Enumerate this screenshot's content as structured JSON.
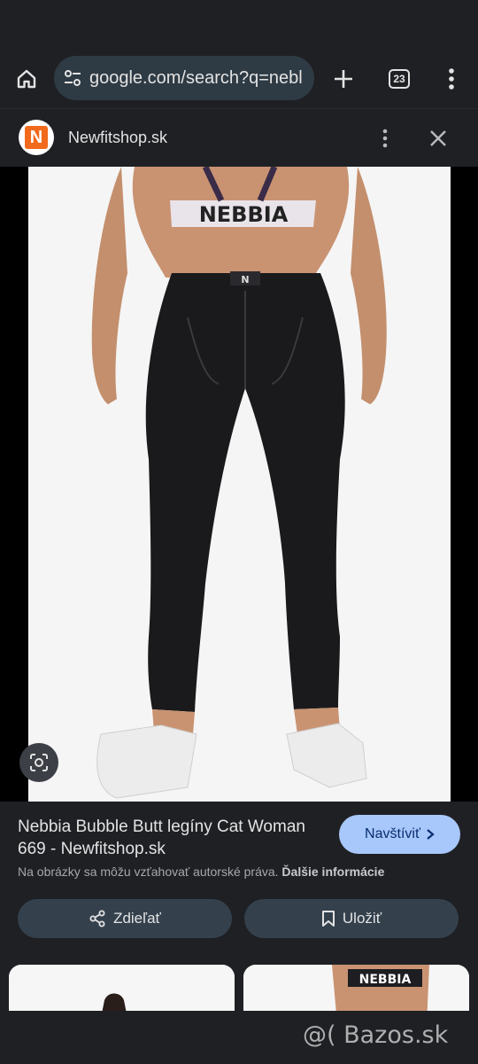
{
  "browser": {
    "url": "google.com/search?q=nebl",
    "tab_count": "23"
  },
  "site": {
    "logo_letter": "N",
    "name": "Newfitshop.sk"
  },
  "image": {
    "brand_text": "NEBBIA",
    "waistband_logo": "N"
  },
  "result": {
    "title": "Nebbia Bubble Butt legíny Cat Woman 669 - Newfitshop.sk",
    "visit_label": "Navštíviť",
    "rights_text": "Na obrázky sa môžu vzťahovať autorské práva.",
    "more_info_label": "Ďalšie informácie",
    "share_label": "Zdieľať",
    "save_label": "Uložiť"
  },
  "related": {
    "thumb2_brand_text": "NEBBIA"
  },
  "watermark": "@( Bazos.sk",
  "colors": {
    "background": "#1f2024",
    "accent_button": "#a8c7fa",
    "secondary_button": "#34414d",
    "logo_orange": "#f26a1b"
  }
}
